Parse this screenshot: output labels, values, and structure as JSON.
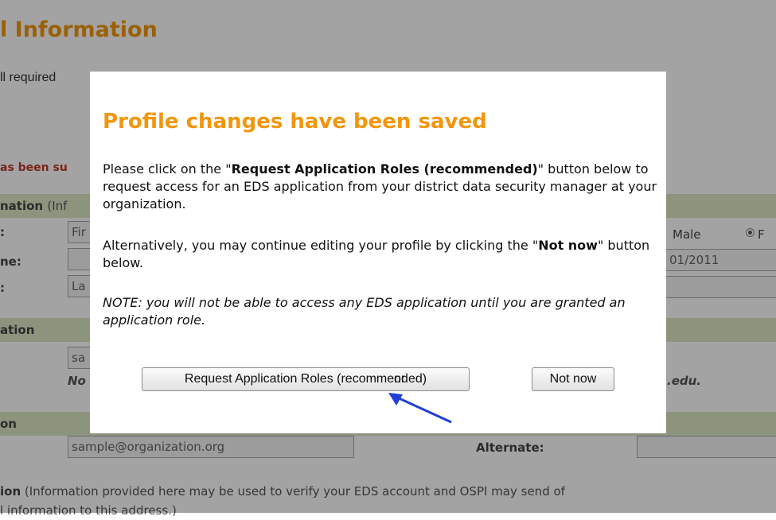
{
  "background": {
    "page_title": "l Information",
    "intro_text": "ll required",
    "saved_message": "as been su",
    "name_section": {
      "label": "nation",
      "sub": "(Inf"
    },
    "labels": {
      "first": ":",
      "middle": "ne:",
      "last": ":"
    },
    "fields": {
      "first": "Fir",
      "middle": "",
      "last": "La"
    },
    "gender": {
      "male": "Male",
      "female": "F"
    },
    "dob": "01/2011",
    "org_section": {
      "label": "ation"
    },
    "org_field": "sa",
    "org_note": "No",
    "edu_note": ".edu.",
    "email_section": {
      "label": "on"
    },
    "email_value": "sample@organization.org",
    "alternate_label": "Alternate:",
    "address_section": {
      "label": "ion",
      "text": "(Information provided here may be used to verify your EDS account and OSPI may send of",
      "line2": "l information to this address.)"
    }
  },
  "modal": {
    "title": "Profile changes have been saved",
    "p1_pre": "Please click on the \"",
    "p1_bold": "Request Application Roles (recommended)",
    "p1_post": "\" button below to request access for an EDS application from your district data security manager at your organization.",
    "p2_pre": "Alternatively, you may continue editing your profile by clicking the \"",
    "p2_bold": "Not now",
    "p2_post": "\" button below.",
    "note": "NOTE: you will not be able to access any EDS application until you are granted an application role.",
    "request_button": "Request Application Roles (recommended)",
    "or_text": "or",
    "not_now_button": "Not now"
  },
  "colors": {
    "title_orange": "#f2960c",
    "band_green": "#dde8c6",
    "arrow_blue": "#1f3fd6"
  }
}
